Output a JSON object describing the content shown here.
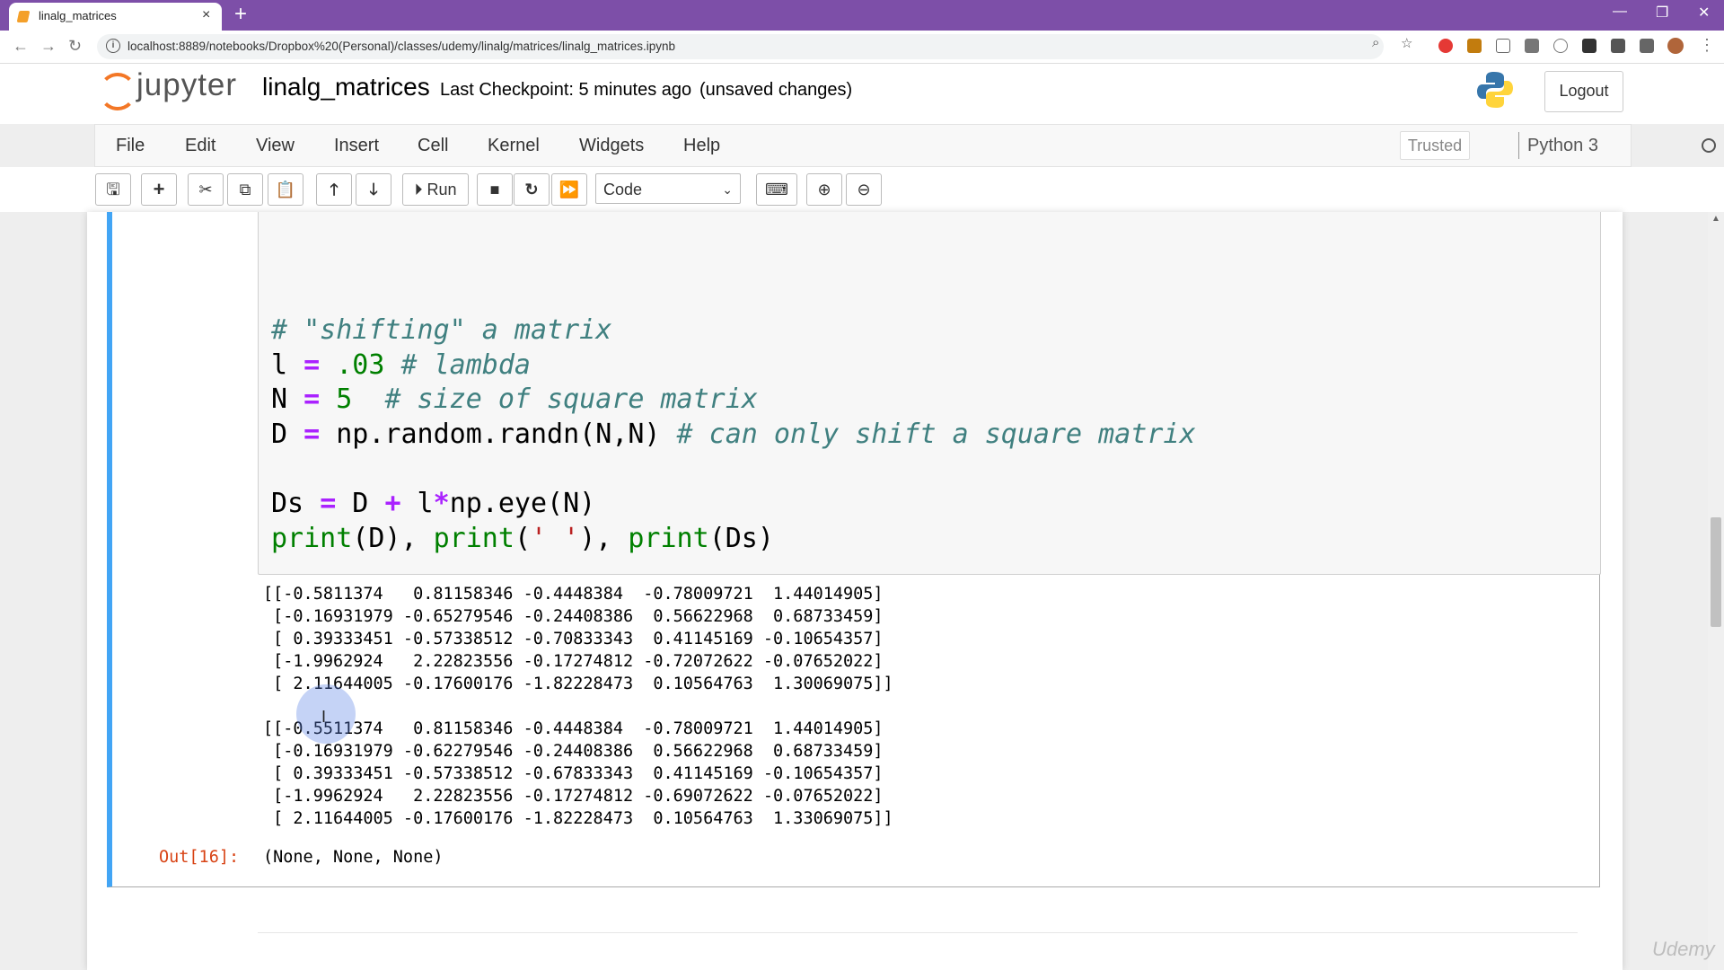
{
  "browser": {
    "tab_title": "linalg_matrices",
    "new_tab": "+",
    "url": "localhost:8889/notebooks/Dropbox%20(Personal)/classes/udemy/linalg/matrices/linalg_matrices.ipynb"
  },
  "header": {
    "logo_text": "jupyter",
    "notebook_name": "linalg_matrices",
    "checkpoint": "Last Checkpoint: 5 minutes ago",
    "unsaved": "(unsaved changes)",
    "logout": "Logout"
  },
  "menu": {
    "items": [
      "File",
      "Edit",
      "View",
      "Insert",
      "Cell",
      "Kernel",
      "Widgets",
      "Help"
    ],
    "trusted": "Trusted",
    "kernel": "Python 3"
  },
  "toolbar": {
    "run_label": "Run",
    "cell_type": "Code"
  },
  "cell": {
    "code": [
      "# \"shifting\" a matrix",
      "l = .03 # lambda",
      "N = 5  # size of square matrix",
      "D = np.random.randn(N,N) # can only shift a square matrix",
      "",
      "Ds = D + l*np.eye(N)",
      "print(D), print(' '), print(Ds)"
    ],
    "output_D": [
      "[[-0.5811374   0.81158346 -0.4448384  -0.78009721  1.44014905]",
      " [-0.16931979 -0.65279546 -0.24408386  0.56622968  0.68733459]",
      " [ 0.39333451 -0.57338512 -0.70833343  0.41145169 -0.10654357]",
      " [-1.9962924   2.22823556 -0.17274812 -0.72072622 -0.07652022]",
      " [ 2.11644005 -0.17600176 -1.82228473  0.10564763  1.30069075]]"
    ],
    "output_Ds": [
      "[[-0.5511374   0.81158346 -0.4448384  -0.78009721  1.44014905]",
      " [-0.16931979 -0.62279546 -0.24408386  0.56622968  0.68733459]",
      " [ 0.39333451 -0.57338512 -0.67833343  0.41145169 -0.10654357]",
      " [-1.9962924   2.22823556 -0.17274812 -0.69072622 -0.07652022]",
      " [ 2.11644005 -0.17600176 -1.82228473  0.10564763  1.33069075]]"
    ],
    "out_prompt": "Out[16]:",
    "out_value": "(None, None, None)"
  },
  "watermark": "Udemy",
  "colors": {
    "tabbar": "#7d4fa8",
    "cell_border_active": "#42a5f5",
    "out_prompt": "#d84315",
    "jupyter_orange": "#f37726"
  }
}
